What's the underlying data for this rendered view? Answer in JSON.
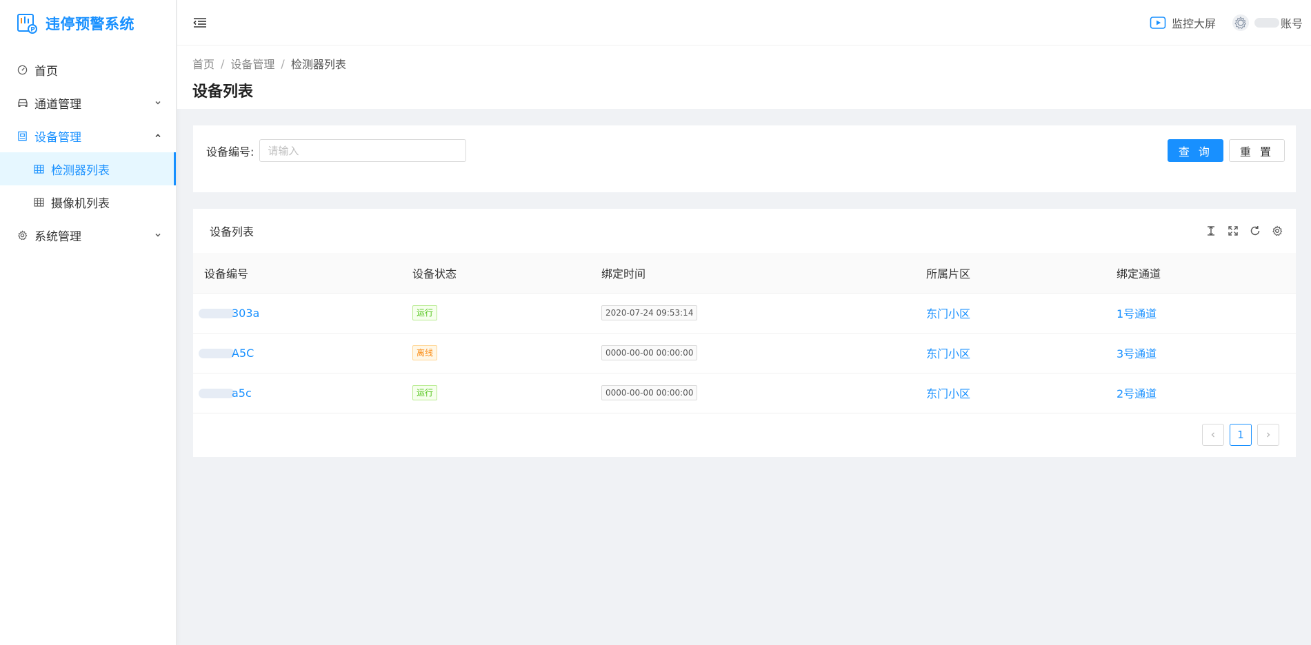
{
  "app": {
    "title": "违停预警系统"
  },
  "colors": {
    "accent": "#1890ff",
    "success": "#52c41a",
    "warning": "#fa8c16"
  },
  "sidebar": {
    "items": [
      {
        "label": "首页",
        "icon": "dashboard-icon"
      },
      {
        "label": "通道管理",
        "icon": "car-icon",
        "expanded": false
      },
      {
        "label": "设备管理",
        "icon": "device-icon",
        "expanded": true,
        "children": [
          {
            "label": "检测器列表",
            "icon": "table-icon",
            "active": true
          },
          {
            "label": "摄像机列表",
            "icon": "table-icon",
            "active": false
          }
        ]
      },
      {
        "label": "系统管理",
        "icon": "gear-icon",
        "expanded": false
      }
    ]
  },
  "header": {
    "monitor_label": "监控大屏",
    "account_label": "账号"
  },
  "breadcrumb": [
    "首页",
    "设备管理",
    "检测器列表"
  ],
  "page_title": "设备列表",
  "search": {
    "label": "设备编号:",
    "placeholder": "请输入",
    "value": "",
    "query_label": "查 询",
    "reset_label": "重 置"
  },
  "table": {
    "title": "设备列表",
    "columns": [
      "设备编号",
      "设备状态",
      "绑定时间",
      "所属片区",
      "绑定通道"
    ],
    "rows": [
      {
        "id_suffix": "303a",
        "status": "运行",
        "status_type": "green",
        "time": "2020-07-24 09:53:14",
        "area": "东门小区",
        "channel": "1号通道"
      },
      {
        "id_suffix": "A5C",
        "status": "离线",
        "status_type": "orange",
        "time": "0000-00-00 00:00:00",
        "area": "东门小区",
        "channel": "3号通道"
      },
      {
        "id_suffix": "a5c",
        "status": "运行",
        "status_type": "green",
        "time": "0000-00-00 00:00:00",
        "area": "东门小区",
        "channel": "2号通道"
      }
    ]
  },
  "pagination": {
    "current": "1"
  }
}
